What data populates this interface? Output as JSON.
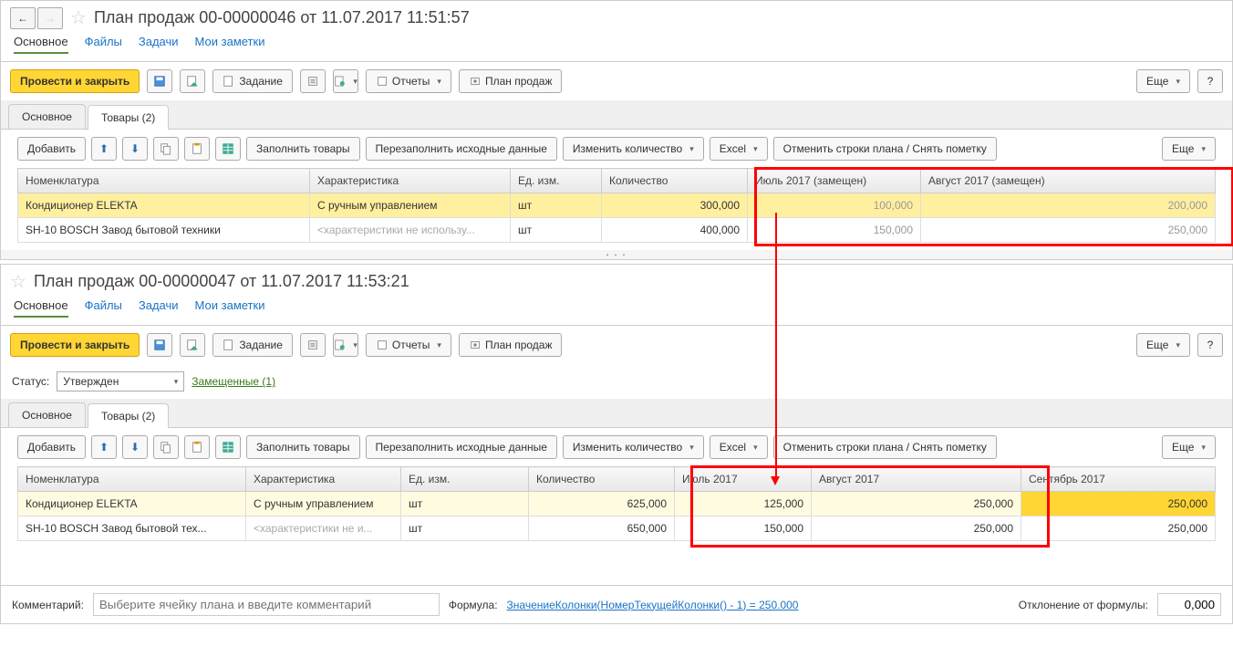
{
  "doc1": {
    "title": "План продаж 00-00000046 от 11.07.2017 11:51:57",
    "nav": {
      "main": "Основное",
      "files": "Файлы",
      "tasks": "Задачи",
      "notes": "Мои заметки"
    },
    "toolbar": {
      "post_close": "Провести и закрыть",
      "task": "Задание",
      "reports": "Отчеты",
      "sales_plan": "План продаж",
      "more": "Еще",
      "help": "?"
    },
    "subtabs": {
      "main": "Основное",
      "goods": "Товары (2)"
    },
    "tbl_toolbar": {
      "add": "Добавить",
      "fill": "Заполнить товары",
      "refill": "Перезаполнить исходные данные",
      "change_qty": "Изменить количество",
      "excel": "Excel",
      "cancel_rows": "Отменить строки плана / Снять пометку",
      "more": "Еще"
    },
    "cols": {
      "nom": "Номенклатура",
      "char": "Характеристика",
      "unit": "Ед. изм.",
      "qty": "Количество",
      "jul": "Июль 2017 (замещен)",
      "aug": "Август 2017 (замещен)"
    },
    "rows": [
      {
        "nom": "Кондиционер ELEKTA",
        "char": "С ручным управлением",
        "unit": "шт",
        "qty": "300,000",
        "jul": "100,000",
        "aug": "200,000"
      },
      {
        "nom": "SH-10 BOSCH Завод бытовой техники",
        "char": "<характеристики не использу...",
        "unit": "шт",
        "qty": "400,000",
        "jul": "150,000",
        "aug": "250,000"
      }
    ]
  },
  "doc2": {
    "title": "План продаж 00-00000047 от 11.07.2017 11:53:21",
    "nav": {
      "main": "Основное",
      "files": "Файлы",
      "tasks": "Задачи",
      "notes": "Мои заметки"
    },
    "toolbar": {
      "post_close": "Провести и закрыть",
      "task": "Задание",
      "reports": "Отчеты",
      "sales_plan": "План продаж",
      "more": "Еще",
      "help": "?"
    },
    "status": {
      "label": "Статус:",
      "value": "Утвержден",
      "replaced": "Замещенные (1)"
    },
    "subtabs": {
      "main": "Основное",
      "goods": "Товары (2)"
    },
    "tbl_toolbar": {
      "add": "Добавить",
      "fill": "Заполнить товары",
      "refill": "Перезаполнить исходные данные",
      "change_qty": "Изменить количество",
      "excel": "Excel",
      "cancel_rows": "Отменить строки плана / Снять пометку",
      "more": "Еще"
    },
    "cols": {
      "nom": "Номенклатура",
      "char": "Характеристика",
      "unit": "Ед. изм.",
      "qty": "Количество",
      "jul": "Июль 2017",
      "aug": "Август 2017",
      "sep": "Сентябрь 2017"
    },
    "rows": [
      {
        "nom": "Кондиционер ELEKTA",
        "char": "С ручным управлением",
        "unit": "шт",
        "qty": "625,000",
        "jul": "125,000",
        "aug": "250,000",
        "sep": "250,000"
      },
      {
        "nom": "SH-10 BOSCH Завод бытовой тех...",
        "char": "<характеристики не и...",
        "unit": "шт",
        "qty": "650,000",
        "jul": "150,000",
        "aug": "250,000",
        "sep": "250,000"
      }
    ],
    "bottom": {
      "comment_label": "Комментарий:",
      "comment_ph": "Выберите ячейку плана и введите комментарий",
      "formula_label": "Формула:",
      "formula": "ЗначениеКолонки(НомерТекущейКолонки() - 1) = 250.000",
      "deviation_label": "Отклонение от формулы:",
      "deviation": "0,000"
    }
  }
}
